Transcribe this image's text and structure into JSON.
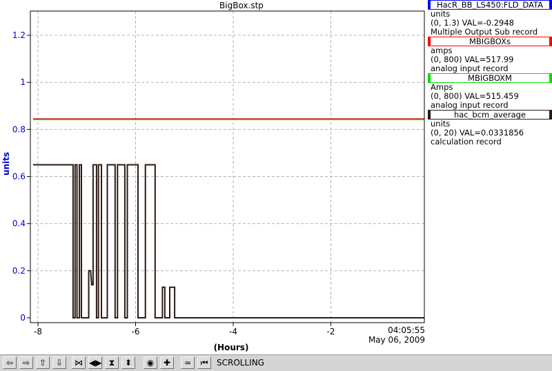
{
  "chart_data": {
    "type": "line",
    "title": "BigBox.stp",
    "xlabel": "(Hours)",
    "ylabel": "units",
    "xlim": [
      -8.1,
      0.2
    ],
    "ylim": [
      0,
      1.3
    ],
    "x_ticks": [
      -8,
      -6,
      -4,
      -2
    ],
    "x_tick_labels": [
      "-8",
      "-6",
      "-4",
      "-2"
    ],
    "y_ticks": [
      0,
      0.2,
      0.4,
      0.6,
      0.8,
      1,
      1.2
    ],
    "y_tick_labels": [
      "0",
      "0.2",
      "0.4",
      "0.6",
      "0.8",
      "1",
      "1.2"
    ],
    "grid": true,
    "time_label": "04:05:55",
    "date_label": "May 06, 2009",
    "series": [
      {
        "name": "MBIGBOXs",
        "color": "#ff0000",
        "points": [
          [
            -8.1,
            0.845
          ],
          [
            0.2,
            0.845
          ]
        ]
      },
      {
        "name": "MBIGBOXM",
        "color": "#00cc00",
        "points": [
          [
            -8.1,
            0.842
          ],
          [
            0.2,
            0.842
          ]
        ]
      },
      {
        "name": "hac_bcm_average",
        "color": "#2b1a12",
        "points": [
          [
            -8.1,
            0.65
          ],
          [
            -7.28,
            0.65
          ],
          [
            -7.28,
            0
          ],
          [
            -7.24,
            0
          ],
          [
            -7.24,
            0.65
          ],
          [
            -7.2,
            0.65
          ],
          [
            -7.2,
            0
          ],
          [
            -7.15,
            0
          ],
          [
            -7.15,
            0.65
          ],
          [
            -7.11,
            0.65
          ],
          [
            -7.11,
            0
          ],
          [
            -6.96,
            0
          ],
          [
            -6.96,
            0.2
          ],
          [
            -6.92,
            0.2
          ],
          [
            -6.9,
            0.14
          ],
          [
            -6.87,
            0.14
          ],
          [
            -6.87,
            0.65
          ],
          [
            -6.8,
            0.65
          ],
          [
            -6.8,
            0
          ],
          [
            -6.76,
            0
          ],
          [
            -6.76,
            0.65
          ],
          [
            -6.7,
            0.65
          ],
          [
            -6.7,
            0
          ],
          [
            -6.58,
            0
          ],
          [
            -6.58,
            0.65
          ],
          [
            -6.42,
            0.65
          ],
          [
            -6.42,
            0
          ],
          [
            -6.37,
            0
          ],
          [
            -6.37,
            0.65
          ],
          [
            -6.22,
            0.65
          ],
          [
            -6.22,
            0
          ],
          [
            -6.17,
            0
          ],
          [
            -6.17,
            0.65
          ],
          [
            -5.95,
            0.65
          ],
          [
            -5.95,
            0
          ],
          [
            -5.8,
            0
          ],
          [
            -5.8,
            0.65
          ],
          [
            -5.6,
            0.65
          ],
          [
            -5.6,
            0
          ],
          [
            -5.45,
            0
          ],
          [
            -5.45,
            0.13
          ],
          [
            -5.4,
            0.13
          ],
          [
            -5.4,
            0
          ],
          [
            -5.3,
            0
          ],
          [
            -5.3,
            0.13
          ],
          [
            -5.2,
            0.13
          ],
          [
            -5.2,
            0
          ],
          [
            0.2,
            0
          ]
        ]
      }
    ]
  },
  "legend": [
    {
      "name": "HacR_BB_LS450:FLD_DATA",
      "border_color": "#0000ff",
      "units": "units",
      "range_value": "(0, 1.3) VAL=-0.2948",
      "record_type": "Multiple Output Sub record"
    },
    {
      "name": "MBIGBOXs",
      "border_color": "#ff0000",
      "units": "amps",
      "range_value": "(0, 800) VAL=517.99",
      "record_type": "analog input record"
    },
    {
      "name": "MBIGBOXM",
      "border_color": "#00dd00",
      "units": "Amps",
      "range_value": "(0, 800) VAL=515.459",
      "record_type": "analog input record"
    },
    {
      "name": "hac_bcm_average",
      "border_color": "#2b1a12",
      "units": "units",
      "range_value": "(0, 20) VAL=0.0331856",
      "record_type": "calculation record"
    }
  ],
  "toolbar": {
    "buttons": [
      {
        "name": "scroll-left-button",
        "glyph": "⇦",
        "icon": "arrow-left-icon"
      },
      {
        "name": "scroll-right-button",
        "glyph": "⇨",
        "icon": "arrow-right-icon"
      },
      {
        "name": "scroll-up-button",
        "glyph": "⇧",
        "icon": "arrow-up-icon"
      },
      {
        "name": "scroll-down-button",
        "glyph": "⇩",
        "icon": "arrow-down-icon"
      },
      {
        "name": "expand-horizontal-button",
        "glyph": "⋈",
        "icon": "expand-horizontal-icon"
      },
      {
        "name": "compress-horizontal-button",
        "glyph": "◀▶",
        "icon": "compress-horizontal-icon"
      },
      {
        "name": "expand-vertical-button",
        "glyph": "⧗",
        "icon": "expand-vertical-icon"
      },
      {
        "name": "compress-vertical-button",
        "glyph": "⬍",
        "icon": "compress-vertical-icon"
      },
      {
        "name": "zoom-out-button",
        "glyph": "◉",
        "icon": "zoom-out-icon"
      },
      {
        "name": "zoom-in-button",
        "glyph": "✚",
        "icon": "zoom-in-icon"
      },
      {
        "name": "scrolling-mode-button",
        "glyph": "≃",
        "icon": "scrolling-mode-icon"
      },
      {
        "name": "stop-scroll-button",
        "glyph": "⏮",
        "icon": "stop-scroll-icon"
      }
    ],
    "mode_label": "SCROLLING"
  }
}
